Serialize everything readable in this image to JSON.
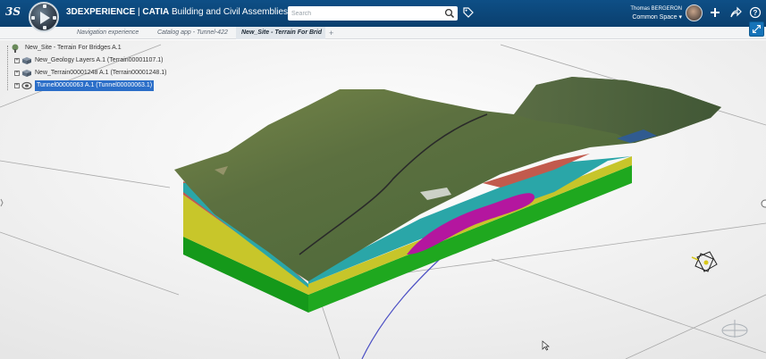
{
  "topbar": {
    "brand": "3S",
    "title_bold": "3DEXPERIENCE",
    "title_sep": " | ",
    "title_app_bold": "CATIA",
    "title_app": " Building and Civil Assemblies",
    "search_placeholder": "Search",
    "user_name": "Thomas BERGERON",
    "user_space": "Common Space"
  },
  "tabs": [
    {
      "label": "Navigation experience"
    },
    {
      "label": "Catalog app - Tunnel-422"
    },
    {
      "label": "New_Site - Terrain For Brid"
    }
  ],
  "tab_add": "+",
  "tree": {
    "root": "New_Site - Terrain For Bridges A.1",
    "items": [
      {
        "label": "New_Geology Layers A.1 (Terrain00001107.1)"
      },
      {
        "label": "New_Terrain00001248 A.1 (Terrain00001248.1)"
      },
      {
        "label": "Tunnel00000063 A.1 (Tunnel00000063.1)"
      }
    ]
  },
  "colors": {
    "topbar": "#0b4579",
    "selection": "#2b6ec8",
    "layer_green": "#1fa81f",
    "layer_yellow": "#c8c62a",
    "layer_cyan": "#2aa6a8",
    "layer_magenta": "#b4169f",
    "layer_red": "#c25a4d"
  }
}
